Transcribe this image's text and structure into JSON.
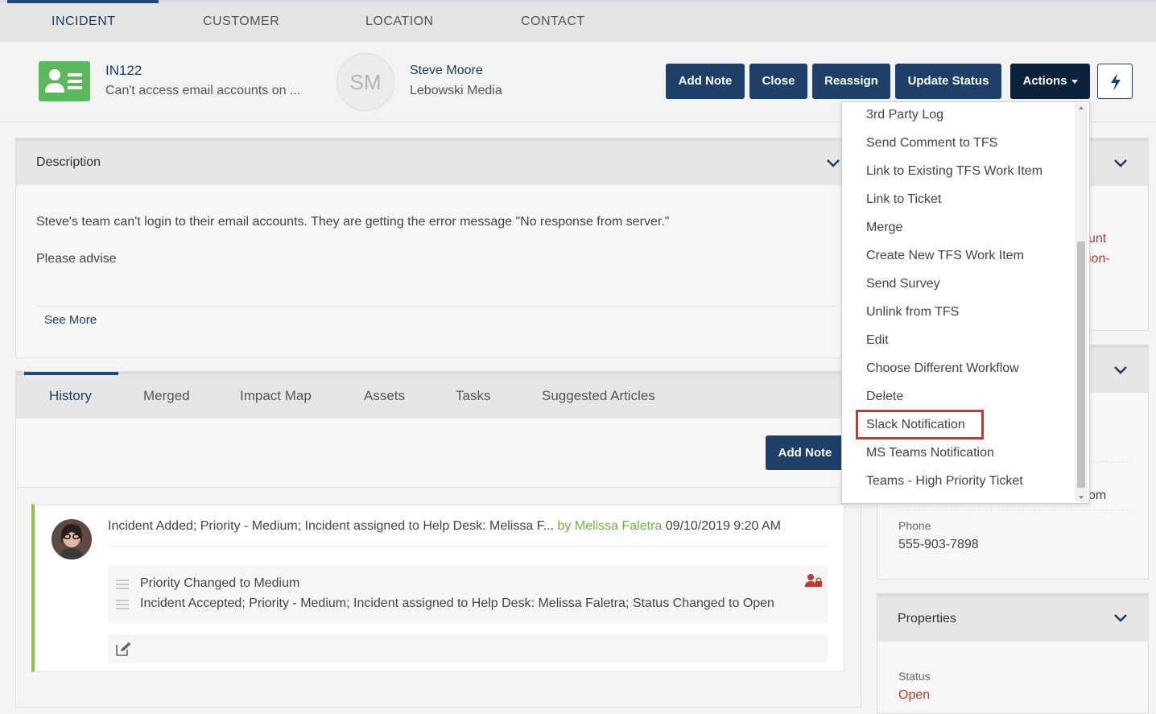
{
  "top_tabs": [
    "INCIDENT",
    "CUSTOMER",
    "LOCATION",
    "CONTACT"
  ],
  "incident": {
    "id": "IN122",
    "title": "Can't access email accounts on ...",
    "icon": "contact-card-icon"
  },
  "customer": {
    "initials": "SM",
    "name": "Steve Moore",
    "company": "Lebowski Media"
  },
  "buttons": {
    "add_note": "Add Note",
    "close": "Close",
    "reassign": "Reassign",
    "update_status": "Update Status",
    "actions": "Actions",
    "quick_action_icon": "lightning-bolt-icon"
  },
  "description": {
    "title": "Description",
    "line1": "Steve's team can't login to their email accounts. They are getting the error message \"No response from server.\"",
    "line2": "Please advise",
    "see_more": "See More"
  },
  "history_tabs": [
    "History",
    "Merged",
    "Impact Map",
    "Assets",
    "Tasks",
    "Suggested Articles"
  ],
  "history": {
    "add_note": "Add Note",
    "entry": {
      "summary": "Incident Added; Priority - Medium; Incident assigned to Help Desk: Melissa F...",
      "by": "by Melissa Faletra",
      "timestamp": "09/10/2019 9:20 AM",
      "details": [
        "Priority Changed to Medium",
        "Incident Accepted; Priority - Medium; Incident assigned to Help Desk: Melissa Faletra; Status Changed to Open"
      ]
    }
  },
  "right_panels": {
    "panel1_partial": [
      "unt",
      "ion-"
    ],
    "panel2_partial": "om",
    "phone_label": "Phone",
    "phone_value": "555-903-7898",
    "properties_title": "Properties",
    "status_label": "Status",
    "status_value": "Open"
  },
  "actions_menu": [
    "3rd Party Log",
    "Send Comment to TFS",
    "Link to Existing TFS Work Item",
    "Link to Ticket",
    "Merge",
    "Create New TFS Work Item",
    "Send Survey",
    "Unlink from TFS",
    "Edit",
    "Choose Different Workflow",
    "Delete",
    "Slack Notification",
    "MS Teams Notification",
    "Teams - High Priority Ticket"
  ],
  "highlighted_menu_item": "Slack Notification",
  "colors": {
    "primary_button": "#1d3f68",
    "actions_button": "#0d213a",
    "incident_icon": "#5cb85c",
    "history_accent": "#8ec641",
    "highlight_box": "#d62c3a",
    "status_open": "#c0392b"
  }
}
